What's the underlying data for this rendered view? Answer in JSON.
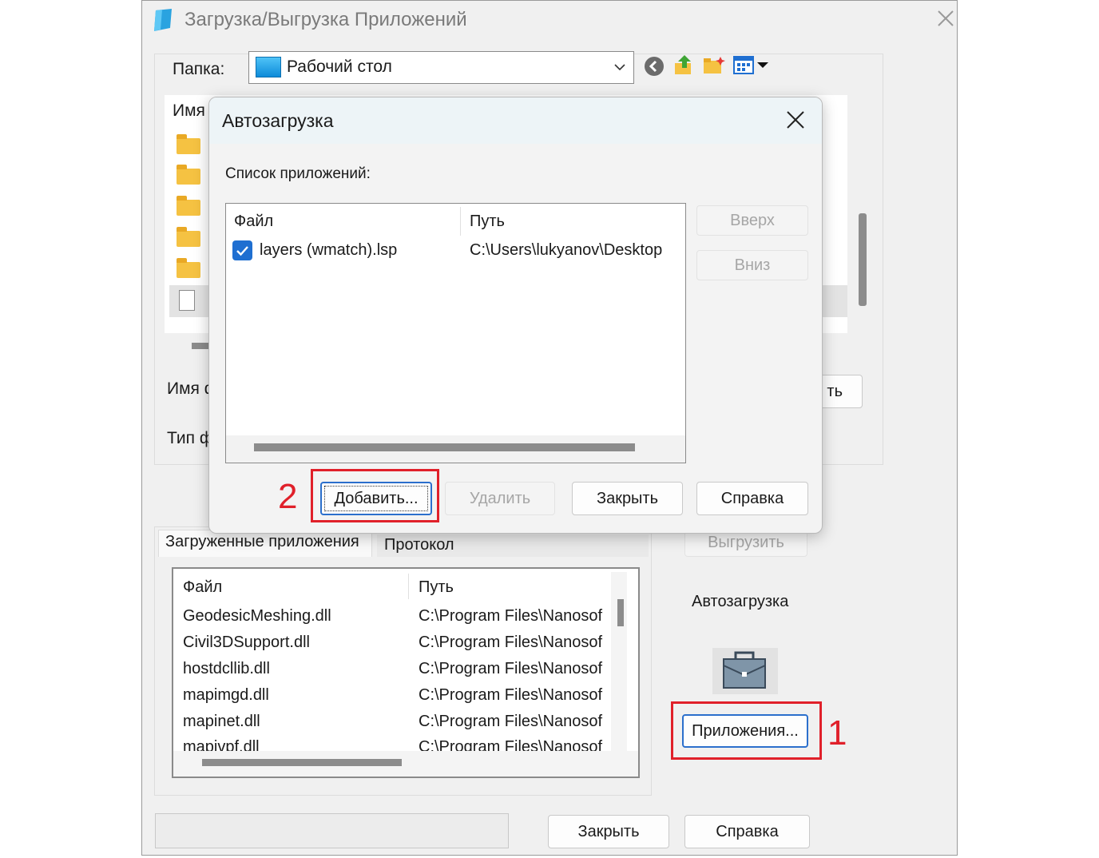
{
  "window": {
    "title": "Загрузка/Выгрузка Приложений",
    "folder_label": "Папка:",
    "folder_value": "Рабочий стол",
    "file_list_header_name": "Имя",
    "file_name_label": "Имя ф",
    "file_type_label": "Тип ф",
    "load_button_partial": "ть",
    "tabs": [
      "Загруженные приложения",
      "Протокол"
    ],
    "unload_button": "Выгрузить",
    "autoload_label": "Автозагрузка",
    "apps_button": "Приложения...",
    "close_button": "Закрыть",
    "help_button": "Справка",
    "loaded_apps": {
      "columns": [
        "Файл",
        "Путь"
      ],
      "rows": [
        {
          "file": "GeodesicMeshing.dll",
          "path": "C:\\Program Files\\Nanosof"
        },
        {
          "file": "Civil3DSupport.dll",
          "path": "C:\\Program Files\\Nanosof"
        },
        {
          "file": "hostdcllib.dll",
          "path": "C:\\Program Files\\Nanosof"
        },
        {
          "file": "mapimgd.dll",
          "path": "C:\\Program Files\\Nanosof"
        },
        {
          "file": "mapinet.dll",
          "path": "C:\\Program Files\\Nanosof"
        },
        {
          "file": "mapivpf.dll",
          "path": "C:\\Program Files\\Nanosof"
        }
      ]
    }
  },
  "dialog": {
    "title": "Автозагрузка",
    "list_label": "Список приложений:",
    "columns": [
      "Файл",
      "Путь"
    ],
    "items": [
      {
        "file": "layers (wmatch).lsp",
        "path": "C:\\Users\\lukyanov\\Desktop",
        "checked": true
      }
    ],
    "up_button": "Вверх",
    "down_button": "Вниз",
    "add_button": "Добавить...",
    "delete_button": "Удалить",
    "close_button": "Закрыть",
    "help_button": "Справка"
  },
  "annotations": {
    "step1": "1",
    "step2": "2",
    "color": "#e0202a"
  }
}
